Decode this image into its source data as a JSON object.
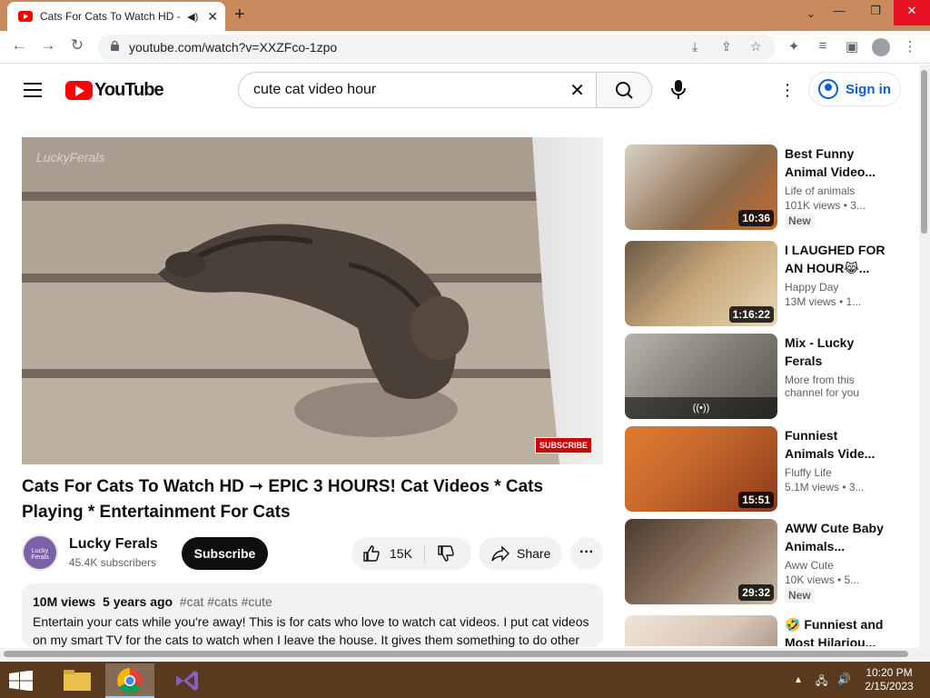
{
  "browser": {
    "tab_title": "Cats For Cats To Watch HD -",
    "url": "youtube.com/watch?v=XXZFco-1zpo",
    "new_tab_label": "+"
  },
  "youtube": {
    "logo_text": "YouTube",
    "search_query": "cute cat video hour",
    "sign_in_label": "Sign in"
  },
  "video": {
    "watermark": "LuckyFerals",
    "subscribe_badge": "SUBSCRIBE",
    "title": "Cats For Cats To Watch HD ➞ EPIC 3 HOURS! Cat Videos * Cats Playing * Entertainment For Cats",
    "channel_name": "Lucky Ferals",
    "channel_avatar_text": "Lucky Ferals",
    "subscribers": "45.4K subscribers",
    "subscribe_label": "Subscribe",
    "likes": "15K",
    "share_label": "Share",
    "views": "10M views",
    "age": "5 years ago",
    "tags": "#cat #cats #cute",
    "description": "Entertain your cats while you're away! This is for cats who love to watch cat videos. I put cat videos on my smart TV for the cats to watch when I leave the house. It gives them something to do other"
  },
  "recommendations": [
    {
      "title": "Best Funny Animal Video...",
      "channel": "Life of animals",
      "views": "101K views  • 3...",
      "duration": "10:36",
      "badge": "New",
      "thumb_color": "#8a6a4c"
    },
    {
      "title": "I LAUGHED FOR AN HOUR😹...",
      "channel": "Happy Day",
      "views": "13M views  • 1...",
      "duration": "1:16:22",
      "badge": "",
      "thumb_color": "#b48e5e"
    },
    {
      "title": "Mix - Lucky Ferals",
      "channel": "More from this channel for you",
      "views": "",
      "duration": "",
      "badge": "",
      "mix_icon": "((•))",
      "thumb_color": "#8e8a86"
    },
    {
      "title": "Funniest Animals Vide...",
      "channel": "Fluffy Life",
      "views": "5.1M views  • 3...",
      "duration": "15:51",
      "badge": "",
      "thumb_color": "#c86a2e"
    },
    {
      "title": "AWW Cute Baby Animals...",
      "channel": "Aww Cute",
      "views": "10K views  • 5...",
      "duration": "29:32",
      "badge": "New",
      "thumb_color": "#8c7460"
    },
    {
      "title": "🤣 Funniest and Most Hilariou...",
      "channel": "",
      "views": "",
      "duration": "",
      "badge": "",
      "thumb_color": "#d9c7b8"
    }
  ],
  "taskbar": {
    "time": "10:20 PM",
    "date": "2/15/2023"
  },
  "colors": {
    "youtube_red": "#ff0000",
    "link_blue": "#065fd4",
    "taskbar": "#5a3a1e",
    "tab_strip": "#c98a5e"
  }
}
